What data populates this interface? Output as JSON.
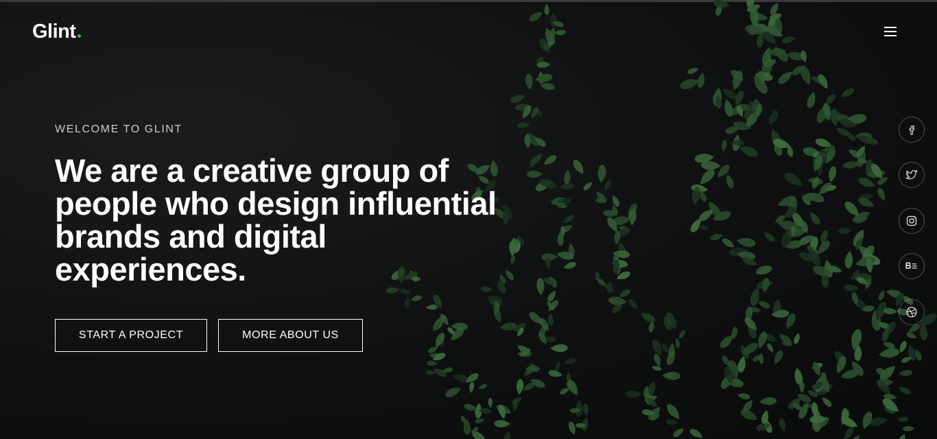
{
  "brand": {
    "name": "Glint",
    "accent_color": "#39b54a"
  },
  "header": {
    "menu_icon": "hamburger-menu-icon"
  },
  "hero": {
    "eyebrow": "WELCOME TO GLINT",
    "headline_lines": [
      "We are a creative group of",
      "people who design influential",
      "brands and digital",
      "experiences."
    ],
    "buttons": {
      "start": "START A PROJECT",
      "more": "MORE ABOUT US"
    }
  },
  "social": [
    {
      "name": "facebook",
      "icon": "facebook-icon"
    },
    {
      "name": "twitter",
      "icon": "twitter-icon"
    },
    {
      "name": "instagram",
      "icon": "instagram-icon"
    },
    {
      "name": "behance",
      "icon": "behance-icon"
    },
    {
      "name": "dribbble",
      "icon": "dribbble-icon"
    }
  ]
}
